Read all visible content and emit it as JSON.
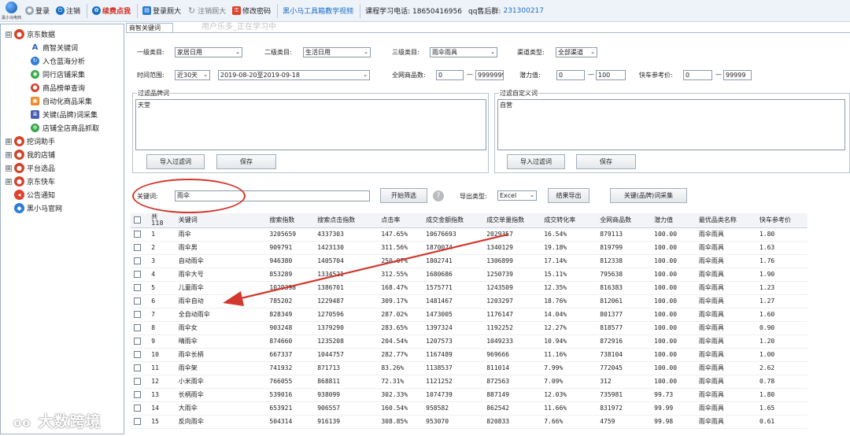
{
  "toolbar": {
    "logo_text": "黑小马电商",
    "items": [
      "登录",
      "注销",
      "续费点我",
      "登录厕大",
      "注销厕大",
      "修改密码",
      "黑小马工具箱教学视频"
    ],
    "phone": "课程学习电话: 18650416956",
    "qq_label": "qq售后群:",
    "qq_value": "231300217",
    "watermark": "用户乐多_正在学习中"
  },
  "sidebar": {
    "groups": [
      {
        "label": "京东数据",
        "expand": "⊟",
        "items": [
          "商智关键词",
          "入仓蓝海分析",
          "同行店铺采集",
          "商品榜单查询",
          "自动化商品采集",
          "关键(品牌)词采集",
          "店铺全店商品抓取"
        ]
      },
      {
        "label": "挖词助手",
        "expand": "⊞"
      },
      {
        "label": "我的店铺",
        "expand": "⊞"
      },
      {
        "label": "平台选品",
        "expand": "⊞"
      },
      {
        "label": "京东快车",
        "expand": "⊞"
      },
      {
        "label": "公告通知",
        "expand": ""
      },
      {
        "label": "黑小马官网",
        "expand": ""
      }
    ]
  },
  "tab": {
    "label": "商智关键词"
  },
  "filters": {
    "cat1_label": "一级类目:",
    "cat1_value": "家居日用",
    "cat2_label": "二级类目:",
    "cat2_value": "生活日用",
    "cat3_label": "三级类目:",
    "cat3_value": "雨伞雨具",
    "channel_label": "渠道类型:",
    "channel_value": "全部渠道",
    "time_label": "时间范围:",
    "time_value": "近30天",
    "date_value": "2019-08-20至2019-09-18",
    "goods_label": "全网商品数:",
    "goods_min": "0",
    "goods_max": "9999999",
    "potential_label": "潜力值:",
    "potential_min": "0",
    "potential_max": "100",
    "express_label": "快车参考价:",
    "express_min": "0",
    "express_max": "99999",
    "dash": "—"
  },
  "brand_filter": {
    "title": "过滤品牌词",
    "text": "天堂",
    "import_label": "导入过滤词",
    "save_label": "保存"
  },
  "custom_filter": {
    "title": "过滤自定义词",
    "text": "自营",
    "import_label": "导入过滤词",
    "save_label": "保存"
  },
  "search": {
    "keyword_label": "关键词:",
    "keyword_value": "雨伞",
    "start_label": "开始筛选",
    "help": "?",
    "export_type_label": "导出类型:",
    "export_type_value": "Excel",
    "export_label": "结果导出",
    "collect_label": "关键(品牌)词采集"
  },
  "table": {
    "total_label": "共",
    "total_count": "118",
    "headers": [
      "关键词",
      "搜索指数",
      "搜索点击指数",
      "点击率",
      "成交金额指数",
      "成交单量指数",
      "成交转化率",
      "全网商品数",
      "潜力值",
      "最优品类名称",
      "快车参考价"
    ],
    "rows": [
      [
        "1",
        "雨伞",
        "3205659",
        "4337303",
        "147.65%",
        "10676693",
        "2029357",
        "16.54%",
        "879113",
        "100.00",
        "雨伞雨具",
        "1.80"
      ],
      [
        "2",
        "雨伞男",
        "909791",
        "1423130",
        "311.56%",
        "1870074",
        "1340129",
        "19.18%",
        "819799",
        "100.00",
        "雨伞雨具",
        "1.63"
      ],
      [
        "3",
        "自动雨伞",
        "946380",
        "1405704",
        "250.07%",
        "1802741",
        "1306899",
        "17.14%",
        "812338",
        "100.00",
        "雨伞雨具",
        "1.76"
      ],
      [
        "4",
        "雨伞大号",
        "853289",
        "1334521",
        "312.55%",
        "1680686",
        "1250739",
        "15.11%",
        "795638",
        "100.00",
        "雨伞雨具",
        "1.90"
      ],
      [
        "5",
        "儿童雨伞",
        "1029398",
        "1386701",
        "168.47%",
        "1575771",
        "1243509",
        "12.35%",
        "816383",
        "100.00",
        "雨伞雨具",
        "1.23"
      ],
      [
        "6",
        "雨伞自动",
        "785202",
        "1229487",
        "309.17%",
        "1481467",
        "1203297",
        "18.76%",
        "812061",
        "100.00",
        "雨伞雨具",
        "1.27"
      ],
      [
        "7",
        "全自动雨伞",
        "828349",
        "1270596",
        "287.02%",
        "1473005",
        "1176147",
        "14.04%",
        "801377",
        "100.00",
        "雨伞雨具",
        "1.60"
      ],
      [
        "8",
        "雨伞女",
        "903248",
        "1379290",
        "283.65%",
        "1397324",
        "1192252",
        "12.27%",
        "818577",
        "100.00",
        "雨伞雨具",
        "0.90"
      ],
      [
        "9",
        "晴雨伞",
        "874660",
        "1235208",
        "204.54%",
        "1207573",
        "1049233",
        "10.94%",
        "872916",
        "100.00",
        "雨伞雨具",
        "1.20"
      ],
      [
        "10",
        "雨伞长柄",
        "667337",
        "1044757",
        "282.77%",
        "1167489",
        "969666",
        "11.16%",
        "738104",
        "100.00",
        "雨伞雨具",
        "1.00"
      ],
      [
        "11",
        "雨伞架",
        "741932",
        "871713",
        "83.26%",
        "1138537",
        "811014",
        "7.99%",
        "772045",
        "100.00",
        "雨伞雨具",
        "2.62"
      ],
      [
        "12",
        "小米雨伞",
        "766055",
        "868811",
        "72.31%",
        "1121252",
        "872563",
        "7.09%",
        "312",
        "100.00",
        "雨伞雨具",
        "0.78"
      ],
      [
        "13",
        "长柄雨伞",
        "539016",
        "938099",
        "302.33%",
        "1074739",
        "887149",
        "12.03%",
        "735981",
        "99.73",
        "雨伞雨具",
        "1.80"
      ],
      [
        "14",
        "大雨伞",
        "653921",
        "906557",
        "160.54%",
        "958582",
        "862542",
        "11.66%",
        "831972",
        "99.99",
        "雨伞雨具",
        "1.65"
      ],
      [
        "15",
        "反向雨伞",
        "504314",
        "916139",
        "308.85%",
        "953070",
        "820833",
        "7.66%",
        "4759",
        "99.98",
        "雨伞雨具",
        "0.61"
      ]
    ]
  },
  "bottom_watermark": "大数跨境",
  "colors": {
    "accent": "#1a6fc6",
    "annotation": "#d2382e"
  }
}
